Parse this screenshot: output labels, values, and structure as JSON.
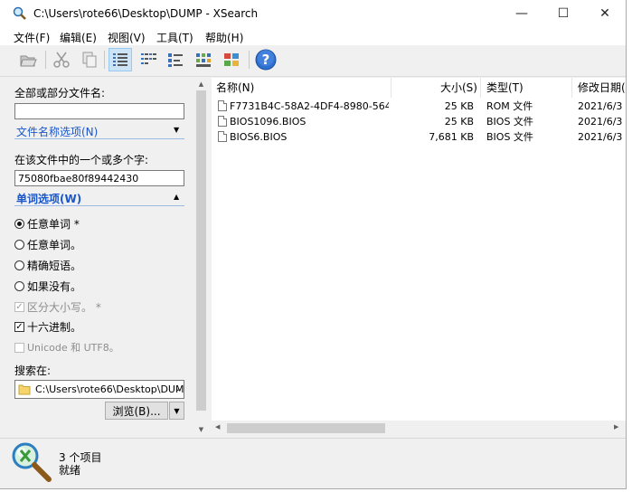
{
  "window": {
    "title": "C:\\Users\\rote66\\Desktop\\DUMP - XSearch",
    "minimize_glyph": "—",
    "maximize_glyph": "☐",
    "close_glyph": "✕"
  },
  "menu": [
    "文件(F)",
    "编辑(E)",
    "视图(V)",
    "工具(T)",
    "帮助(H)"
  ],
  "toolbar_icons": [
    "open-folder-icon",
    "cut-icon",
    "copy-icon",
    "details-view-icon",
    "list-view-icon",
    "small-icons-view-icon",
    "thumbnails-view-icon",
    "large-icons-view-icon",
    "help-icon"
  ],
  "search_panel": {
    "filename_label": "全部或部分文件名:",
    "filename_value": "",
    "filename_options_link": "文件名称选项(N)",
    "content_label": "在该文件中的一个或多个字:",
    "content_value": "75080fbae80f89442430",
    "word_options_link": "单词选项(W)",
    "radios": [
      {
        "label": "任意单词 *",
        "selected": true
      },
      {
        "label": "任意单词。",
        "selected": false
      },
      {
        "label": "精确短语。",
        "selected": false
      },
      {
        "label": "如果没有。",
        "selected": false
      }
    ],
    "checks": [
      {
        "label": "区分大小写。 *",
        "checked": true,
        "disabled": true
      },
      {
        "label": "十六进制。",
        "checked": true,
        "disabled": false
      },
      {
        "label": "Unicode 和 UTF8。",
        "checked": false,
        "disabled": true
      }
    ],
    "search_in_label": "搜索在:",
    "search_in_value": "C:\\Users\\rote66\\Desktop\\DUMP",
    "browse_button": "浏览(B)..."
  },
  "results": {
    "columns": [
      "名称(N)",
      "大小(S)",
      "类型(T)",
      "修改日期("
    ],
    "rows": [
      {
        "name": "F7731B4C-58A2-4DF4-8980-564...",
        "size": "25 KB",
        "type": "ROM 文件",
        "date": "2021/6/3"
      },
      {
        "name": "BIOS1096.BIOS",
        "size": "25 KB",
        "type": "BIOS 文件",
        "date": "2021/6/3"
      },
      {
        "name": "BIOS6.BIOS",
        "size": "7,681 KB",
        "type": "BIOS 文件",
        "date": "2021/6/3"
      }
    ]
  },
  "status": {
    "count": "3 个项目",
    "state": "就绪"
  },
  "colors": {
    "accent": "#1a56c9",
    "selection": "#cce4f7",
    "help_blue": "#2f6fd0"
  }
}
